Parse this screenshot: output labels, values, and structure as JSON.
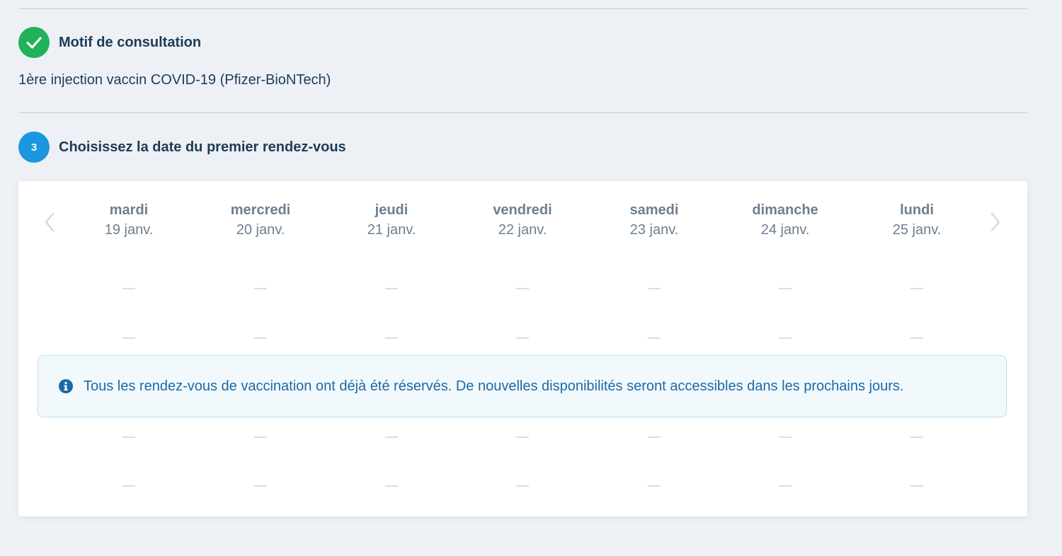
{
  "motif": {
    "title": "Motif de consultation",
    "value": "1ère injection vaccin COVID-19 (Pfizer-BioNTech)"
  },
  "step3": {
    "number": "3",
    "title": "Choisissez la date du premier rendez-vous"
  },
  "calendar": {
    "days": [
      {
        "name": "mardi",
        "date": "19 janv."
      },
      {
        "name": "mercredi",
        "date": "20 janv."
      },
      {
        "name": "jeudi",
        "date": "21 janv."
      },
      {
        "name": "vendredi",
        "date": "22 janv."
      },
      {
        "name": "samedi",
        "date": "23 janv."
      },
      {
        "name": "dimanche",
        "date": "24 janv."
      },
      {
        "name": "lundi",
        "date": "25 janv."
      }
    ],
    "info_message": "Tous les rendez-vous de vaccination ont déjà été réservés. De nouvelles disponibilités seront accessibles dans les prochains jours."
  },
  "colors": {
    "done_badge": "#20b25a",
    "current_badge": "#1b97e0",
    "info_text": "#1c6aa6"
  }
}
